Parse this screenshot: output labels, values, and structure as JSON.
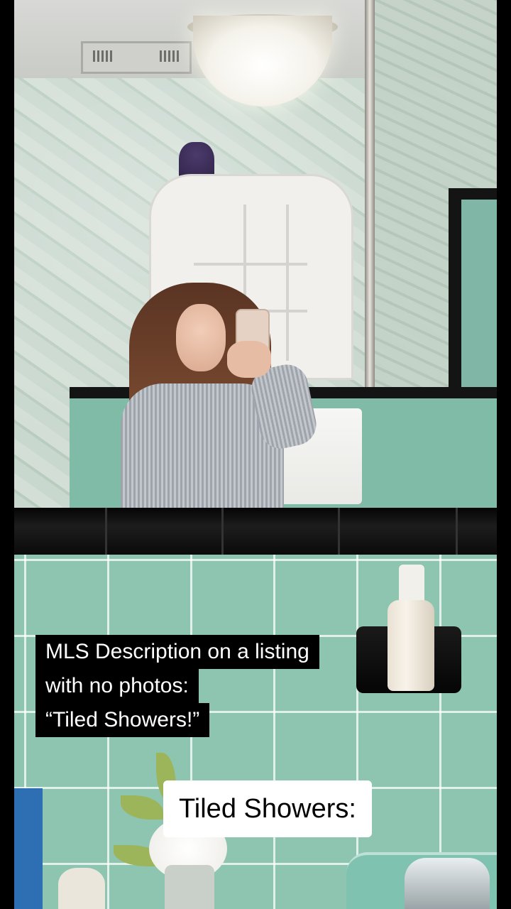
{
  "overlay": {
    "caption_lines": [
      "MLS Description on a listing",
      "with no photos:",
      "“Tiled Showers!”"
    ],
    "tag_text": "Tiled Showers:"
  },
  "colors": {
    "tile": "#8dc5b1",
    "trim": "#0a0a0a",
    "caption_bg": "#000000",
    "caption_text": "#ffffff",
    "tag_bg": "#ffffff",
    "tag_text": "#000000"
  }
}
